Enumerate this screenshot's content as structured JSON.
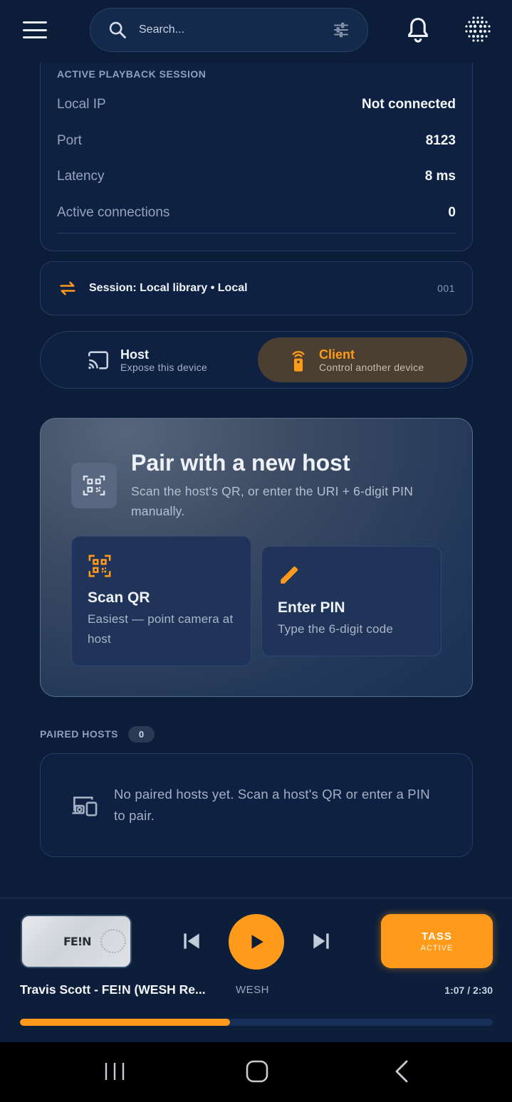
{
  "header": {
    "search_placeholder": "Search...",
    "icons": {
      "menu": "hamburger-menu-icon",
      "search": "search-icon",
      "filter": "tune-sliders-icon",
      "notifications": "bell-icon",
      "apps": "dot-grid-icon"
    }
  },
  "session_info": {
    "title": "ACTIVE PLAYBACK SESSION",
    "rows": [
      {
        "label": "Local IP",
        "value": "Not connected"
      },
      {
        "label": "Port",
        "value": "8123"
      },
      {
        "label": "Latency",
        "value": "8 ms"
      },
      {
        "label": "Active connections",
        "value": "0"
      }
    ]
  },
  "session_line": {
    "text": "Session: Local library • Local",
    "id": "001",
    "icon": "swap-arrows-icon"
  },
  "mode_toggle": {
    "host": {
      "title": "Host",
      "subtitle": "Expose this device",
      "icon": "cast-icon",
      "selected": false
    },
    "client": {
      "title": "Client",
      "subtitle": "Control another device",
      "icon": "remote-control-icon",
      "selected": true
    }
  },
  "pair": {
    "title": "Pair with a new host",
    "subtitle": "Scan the host's QR, or enter the URI + 6-digit PIN manually.",
    "scan": {
      "title": "Scan QR",
      "subtitle": "Easiest — point camera at host",
      "icon": "qr-scan-icon"
    },
    "pin": {
      "title": "Enter PIN",
      "subtitle": "Type the 6-digit code",
      "icon": "pencil-icon"
    }
  },
  "paired_hosts": {
    "label": "PAIRED HOSTS",
    "count": "0",
    "empty_text": "No paired hosts yet. Scan a host's QR or enter a PIN to pair.",
    "icon": "devices-icon"
  },
  "player": {
    "art_text": "FE!N",
    "track": "Travis Scott - FE!N (WESH Re...",
    "artist": "WESH",
    "time": "1:07 / 2:30",
    "progress": 0.445,
    "tass_label": "TASS",
    "tass_status": "ACTIVE"
  },
  "colors": {
    "background": "#0b1d38",
    "accent": "#ff9a1a",
    "card": "#0e2142"
  }
}
